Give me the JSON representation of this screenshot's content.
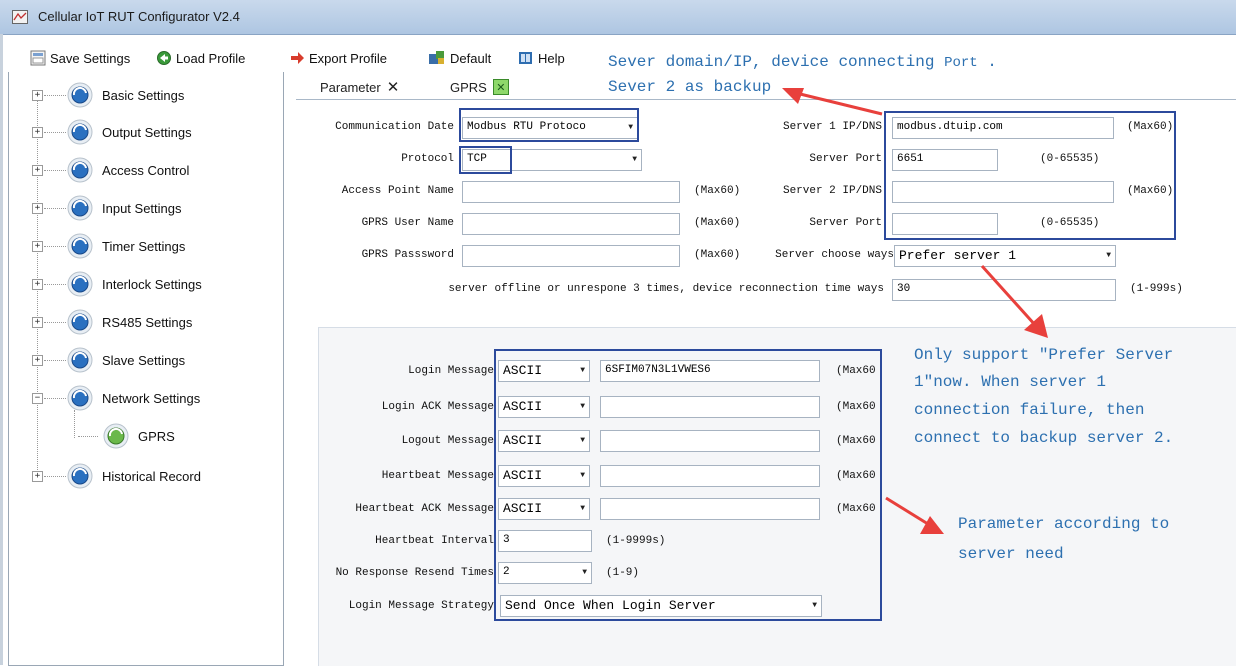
{
  "window": {
    "title": "Cellular IoT RUT Configurator V2.4"
  },
  "toolbar": {
    "save_label": "Save Settings",
    "load_label": "Load Profile",
    "export_label": "Export Profile",
    "default_label": "Default",
    "help_label": "Help"
  },
  "tree": {
    "items": [
      {
        "label": "Basic Settings"
      },
      {
        "label": "Output Settings"
      },
      {
        "label": "Access Control"
      },
      {
        "label": "Input Settings"
      },
      {
        "label": "Timer Settings"
      },
      {
        "label": "Interlock Settings"
      },
      {
        "label": "RS485 Settings"
      },
      {
        "label": "Slave Settings"
      },
      {
        "label": "Network Settings"
      },
      {
        "label": "GPRS"
      },
      {
        "label": "Historical Record"
      }
    ],
    "expand_plus": "+",
    "expand_minus": "−"
  },
  "tabs": {
    "parameter_label": "Parameter",
    "gprs_label": "GPRS"
  },
  "form": {
    "communication_date_label": "Communication Date",
    "communication_date_value": "Modbus RTU Protoco",
    "protocol_label": "Protocol",
    "protocol_value": "TCP",
    "apn_label": "Access Point Name",
    "apn_value": "",
    "apn_hint": "(Max60)",
    "gprs_user_label": "GPRS  User Name",
    "gprs_user_value": "",
    "gprs_user_hint": "(Max60)",
    "gprs_pass_label": "GPRS Passsword",
    "gprs_pass_value": "",
    "gprs_pass_hint": "(Max60)",
    "server1_label": "Server 1 IP/DNS",
    "server1_value": "modbus.dtuip.com",
    "server1_hint": "(Max60)",
    "server1_port_label": "Server Port",
    "server1_port_value": "6651",
    "server1_port_hint": "(0-65535)",
    "server2_label": "Server 2 IP/DNS",
    "server2_value": "",
    "server2_hint": "(Max60)",
    "server2_port_label": "Server Port",
    "server2_port_value": "",
    "server2_port_hint": "(0-65535)",
    "server_choose_label": "Server choose ways",
    "server_choose_value": "Prefer server 1",
    "reconnect_label": "server offline or unrespone 3 times, device reconnection time ways",
    "reconnect_value": "30",
    "reconnect_hint": "(1-999s)"
  },
  "messages": {
    "login_label": "Login Message",
    "login_enc": "ASCII",
    "login_value": "6SFIM07N3L1VWES6",
    "login_ack_label": "Login ACK Message",
    "login_ack_enc": "ASCII",
    "login_ack_value": "",
    "logout_label": "Logout Message",
    "logout_enc": "ASCII",
    "logout_value": "",
    "heartbeat_label": "Heartbeat Message",
    "heartbeat_enc": "ASCII",
    "heartbeat_value": "",
    "heartbeat_ack_label": "Heartbeat ACK Message",
    "heartbeat_ack_enc": "ASCII",
    "heartbeat_ack_value": "",
    "max_hint": "(Max60",
    "interval_label": "Heartbeat Interval",
    "interval_value": "3",
    "interval_hint": "(1-9999s)",
    "resend_label": "No Response Resend Times",
    "resend_value": "2",
    "resend_hint": "(1-9)",
    "strategy_label": "Login Message Strategy",
    "strategy_value": "Send Once When Login Server"
  },
  "annotations": {
    "line1a": "Sever domain/IP, device connecting",
    "line1b": "Port",
    "line1c": ".",
    "line2": "Sever 2 as backup",
    "note1": "Only support \"Prefer Server",
    "note2": "1\"now. When server 1",
    "note3": "connection failure, then",
    "note4": "connect to backup server 2.",
    "note5": "Parameter according to",
    "note6": "server need"
  },
  "colors": {
    "annotation": "#2d70b0",
    "box": "#2c4a9c",
    "arrow": "#e8403c"
  }
}
